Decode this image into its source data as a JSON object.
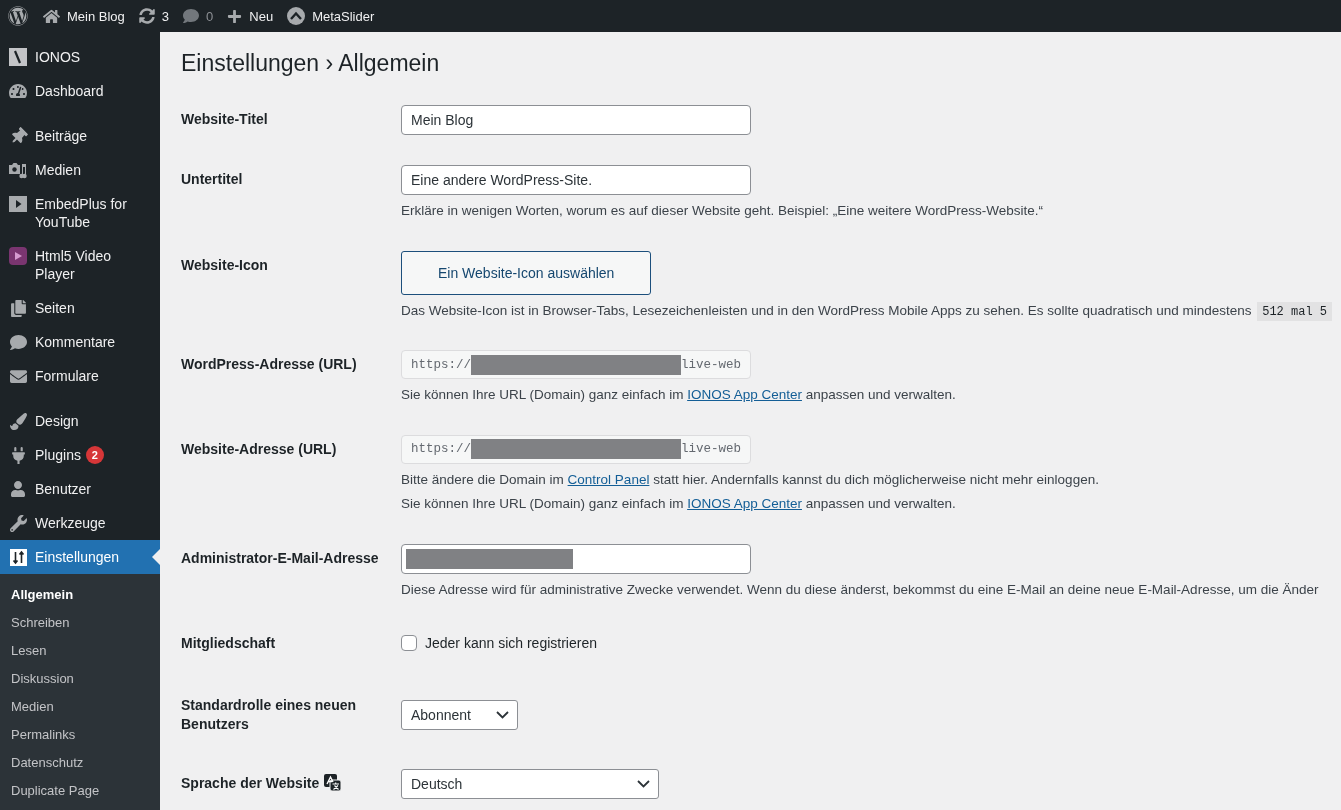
{
  "admin_bar": {
    "items": [
      {
        "label": "Mein Blog",
        "dimmed": false
      },
      {
        "label": "3",
        "dimmed": false
      },
      {
        "label": "0",
        "dimmed": true
      },
      {
        "label": "Neu",
        "dimmed": false
      },
      {
        "label": "MetaSlider",
        "dimmed": false
      }
    ]
  },
  "sidebar": {
    "groups": [
      {
        "items": [
          {
            "label": "IONOS",
            "selected": false
          },
          {
            "label": "Dashboard",
            "selected": false
          }
        ]
      },
      {
        "items": [
          {
            "label": "Beiträge",
            "selected": false
          },
          {
            "label": "Medien",
            "selected": false
          },
          {
            "label": "EmbedPlus for YouTube",
            "selected": false
          },
          {
            "label": "Html5 Video Player",
            "selected": false
          },
          {
            "label": "Seiten",
            "selected": false
          },
          {
            "label": "Kommentare",
            "selected": false
          },
          {
            "label": "Formulare",
            "selected": false
          }
        ]
      },
      {
        "items": [
          {
            "label": "Design",
            "selected": false
          },
          {
            "label": "Plugins",
            "selected": false,
            "badge": "2"
          },
          {
            "label": "Benutzer",
            "selected": false
          },
          {
            "label": "Werkzeuge",
            "selected": false
          },
          {
            "label": "Einstellungen",
            "selected": true,
            "submenu": [
              {
                "label": "Allgemein",
                "selected": true
              },
              {
                "label": "Schreiben",
                "selected": false
              },
              {
                "label": "Lesen",
                "selected": false
              },
              {
                "label": "Diskussion",
                "selected": false
              },
              {
                "label": "Medien",
                "selected": false
              },
              {
                "label": "Permalinks",
                "selected": false
              },
              {
                "label": "Datenschutz",
                "selected": false
              },
              {
                "label": "Duplicate Page",
                "selected": false
              }
            ]
          }
        ]
      }
    ]
  },
  "page": {
    "title": "Einstellungen › Allgemein",
    "settings": [
      {
        "label": "Website-Titel",
        "kind": "text",
        "value": "Mein Blog"
      },
      {
        "label": "Untertitel",
        "kind": "text",
        "value": "Eine andere WordPress-Site.",
        "descriptions": [
          [
            {
              "kind": "text",
              "text": "Erkläre in wenigen Worten, worum es auf dieser Website geht. Beispiel: „Eine weitere WordPress-Website.“"
            }
          ]
        ]
      },
      {
        "label": "Website-Icon",
        "kind": "button",
        "button": "Ein Website-Icon auswählen",
        "descriptions": [
          [
            {
              "kind": "text",
              "text": "Das Website-Icon ist in Browser-Tabs, Lesezeichenleisten und in den WordPress Mobile Apps zu sehen. Es sollte quadratisch und mindestens "
            },
            {
              "kind": "code",
              "text": "512 mal 5"
            }
          ]
        ]
      },
      {
        "label": "WordPress-Adresse (URL)",
        "kind": "url",
        "value_start": "https://",
        "redacted": true,
        "value_end": "live-web",
        "descriptions": [
          [
            {
              "kind": "text",
              "text": "Sie können Ihre URL (Domain) ganz einfach im "
            },
            {
              "kind": "link",
              "text": "IONOS App Center"
            },
            {
              "kind": "text",
              "text": " anpassen und verwalten."
            }
          ]
        ]
      },
      {
        "label": "Website-Adresse (URL)",
        "kind": "url",
        "value_start": "https://",
        "redacted": true,
        "value_end": "live-web",
        "descriptions": [
          [
            {
              "kind": "text",
              "text": "Bitte ändere die Domain im "
            },
            {
              "kind": "link",
              "text": "Control Panel"
            },
            {
              "kind": "text",
              "text": " statt hier. Andernfalls kannst du dich möglicherweise nicht mehr einloggen."
            }
          ],
          [
            {
              "kind": "text",
              "text": "Sie können Ihre URL (Domain) ganz einfach im "
            },
            {
              "kind": "link",
              "text": "IONOS App Center"
            },
            {
              "kind": "text",
              "text": " anpassen und verwalten."
            }
          ]
        ]
      },
      {
        "label": "Administrator-E-Mail-Adresse",
        "kind": "email",
        "redacted": true,
        "descriptions": [
          [
            {
              "kind": "text",
              "text": "Diese Adresse wird für administrative Zwecke verwendet. Wenn du diese änderst, bekommst du eine E-Mail an deine neue E-Mail-Adresse, um die Änder"
            }
          ]
        ]
      },
      {
        "label": "Mitgliedschaft",
        "kind": "checkbox",
        "option": "Jeder kann sich registrieren",
        "checked": false
      },
      {
        "label": "Standardrolle eines neuen Benutzers",
        "kind": "select",
        "value": "Abonnent"
      },
      {
        "label": "Sprache der Website",
        "kind": "language_select",
        "value": "Deutsch"
      }
    ]
  }
}
